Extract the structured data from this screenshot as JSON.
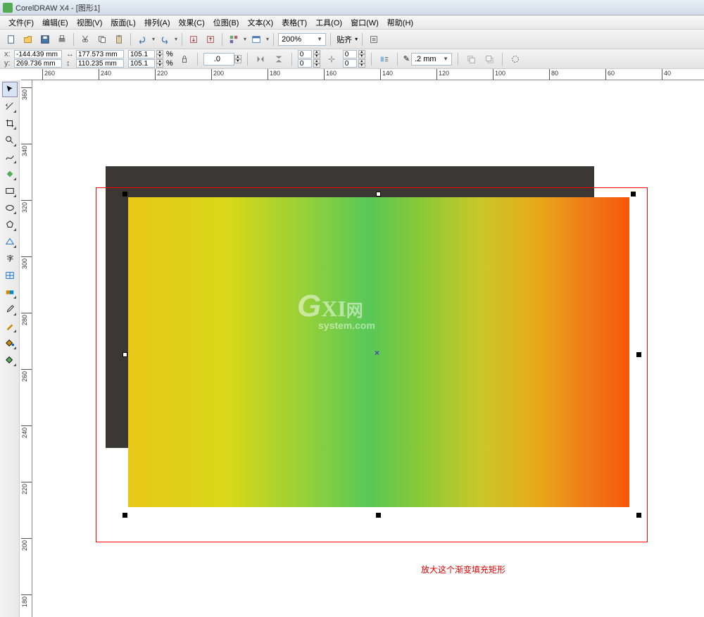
{
  "title": "CorelDRAW X4 - [图形1]",
  "menu": [
    "文件(F)",
    "编辑(E)",
    "视图(V)",
    "版面(L)",
    "排列(A)",
    "效果(C)",
    "位图(B)",
    "文本(X)",
    "表格(T)",
    "工具(O)",
    "窗口(W)",
    "帮助(H)"
  ],
  "zoom": "200%",
  "snap_label": "贴齐",
  "coords": {
    "x": "-144.439 mm",
    "y": "269.736 mm"
  },
  "size": {
    "w": "177.573 mm",
    "h": "110.235 mm"
  },
  "scale": {
    "x": "105.1",
    "y": "105.1"
  },
  "rotation": ".0",
  "spinvals": {
    "a": "0",
    "b": "0",
    "c": "0",
    "d": "0"
  },
  "outline_width": ".2 mm",
  "ruler_h": [
    260,
    240,
    220,
    200,
    180,
    160,
    140,
    120,
    100,
    80,
    60,
    40
  ],
  "ruler_v": [
    360,
    340,
    320,
    300,
    280,
    260,
    240,
    220,
    200,
    180
  ],
  "annotation": "放大这个渐变填充矩形",
  "watermark_main": "GXI网",
  "watermark_sub": "system.com"
}
